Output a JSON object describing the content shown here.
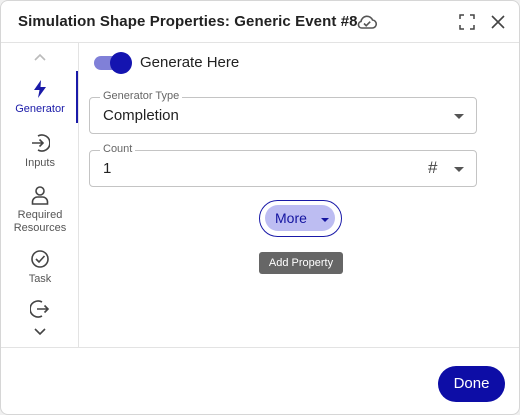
{
  "dialog": {
    "title": "Simulation Shape Properties: Generic Event #8",
    "icons": {
      "cloud": "cloud-icon",
      "expand": "expand-icon",
      "close": "close-icon"
    }
  },
  "nav": {
    "items": [
      {
        "label": "Generator",
        "icon": "bolt-icon",
        "active": true
      },
      {
        "label": "Inputs",
        "icon": "input-arrow-icon",
        "active": false
      },
      {
        "label": "Required\nResources",
        "icon": "person-icon",
        "active": false
      },
      {
        "label": "Task",
        "icon": "check-circle-icon",
        "active": false
      },
      {
        "label": "",
        "icon": "output-arrow-icon",
        "active": false
      }
    ]
  },
  "generate_toggle": {
    "label": "Generate Here",
    "on": true
  },
  "generator_type": {
    "label": "Generator Type",
    "value": "Completion"
  },
  "count": {
    "label": "Count",
    "value": "1",
    "type_symbol": "#"
  },
  "more_button": {
    "label": "More"
  },
  "tooltip": {
    "text": "Add Property"
  },
  "footer": {
    "done_label": "Done"
  },
  "colors": {
    "accent": "#1414b0",
    "accent_light": "#bdbdf2",
    "done_bg": "#0d0da6"
  }
}
